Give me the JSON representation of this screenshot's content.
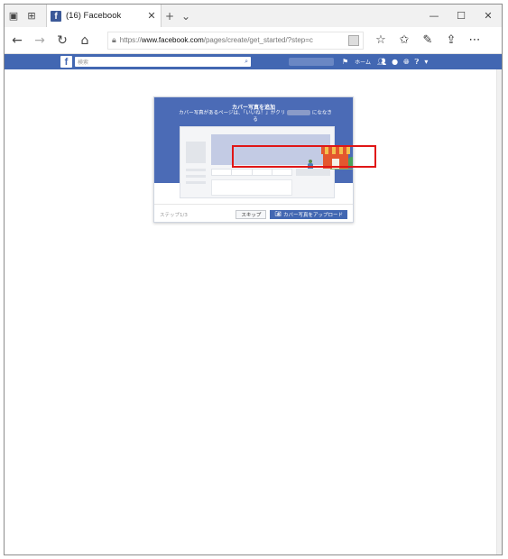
{
  "browser": {
    "tab_title": "(16) Facebook",
    "tab_close": "✕",
    "new_tab": "+",
    "tab_menu": "⌄",
    "url_prefix": "https://",
    "url_domain": "www.facebook.com",
    "url_path": "/pages/create/get_started/?step=c",
    "window_minimize": "—",
    "window_maximize": "☐",
    "window_close": "✕"
  },
  "facebook": {
    "logo": "f",
    "search_placeholder": "検索",
    "home_label": "ホーム"
  },
  "modal": {
    "title": "カバー写真を追加",
    "description_before": "カバー写真があるページは、「いいね！」がクリ",
    "description_after": "にななき",
    "description_line2": "る",
    "step_text": "ステップ1/3",
    "skip_label": "スキップ",
    "upload_label": "カバー写真をアップロード"
  },
  "colors": {
    "facebook_blue": "#4267b2",
    "highlight_red": "#e01616"
  }
}
